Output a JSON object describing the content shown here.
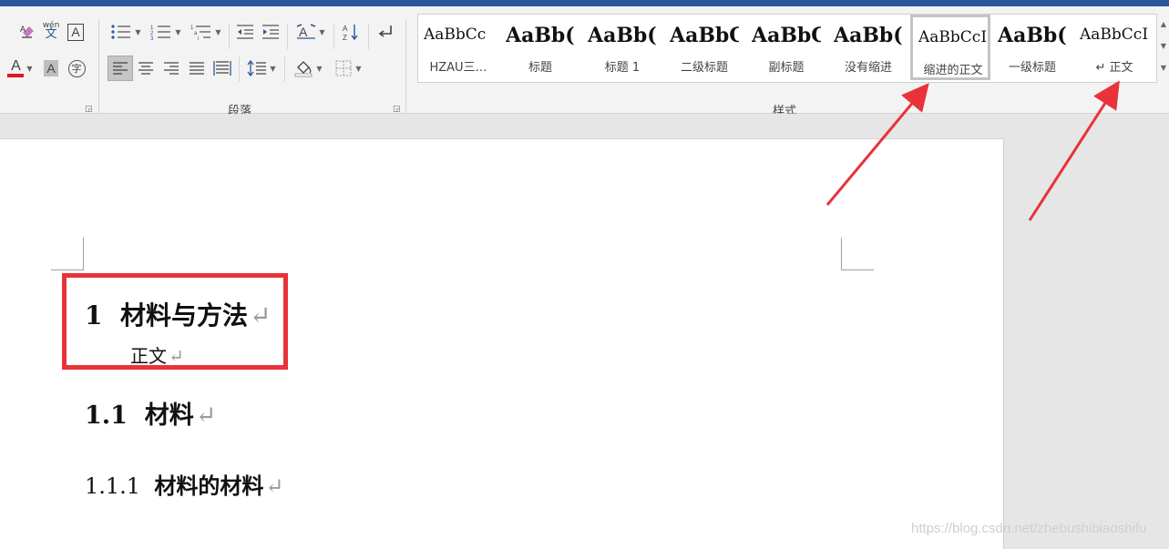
{
  "ribbon": {
    "groups": {
      "paragraph": "段落",
      "styles": "样式"
    }
  },
  "styles": [
    {
      "preview": "AaBbCc",
      "label": "HZAU三…",
      "bold": false
    },
    {
      "preview": "AaBb(",
      "label": "标题",
      "bold": true
    },
    {
      "preview": "AaBb(",
      "label": "标题 1",
      "bold": true
    },
    {
      "preview": "AaBbC",
      "label": "二级标题",
      "bold": true
    },
    {
      "preview": "AaBbC",
      "label": "副标题",
      "bold": true
    },
    {
      "preview": "AaBb(",
      "label": "没有缩进",
      "bold": true
    },
    {
      "preview": "AaBbCcI",
      "label": "缩进的正文",
      "bold": false,
      "selected": true
    },
    {
      "preview": "AaBb(",
      "label": "一级标题",
      "bold": true
    },
    {
      "preview": "AaBbCcI",
      "label": "↵ 正文",
      "bold": false
    }
  ],
  "document": {
    "heading1": {
      "number": "1",
      "title": "材料与方法"
    },
    "body": "正文",
    "heading2": {
      "number": "1.1",
      "title": "材料"
    },
    "heading3": {
      "number": "1.1.1",
      "title": "材料的材料"
    },
    "paragraph_mark": "↵"
  },
  "icons": {
    "font_color": "#e81123",
    "accent": "#2b579a",
    "annotation": "#e8333a"
  },
  "watermark": "https://blog.csdn.net/zhebushibiaoshifu"
}
